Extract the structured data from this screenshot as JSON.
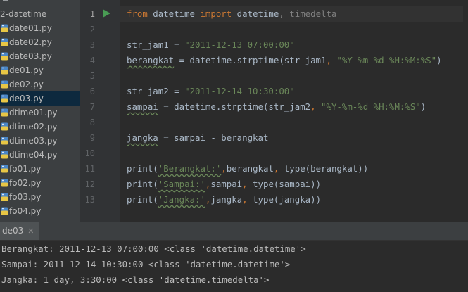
{
  "project_tree": {
    "root_label": "2-datetime",
    "files": [
      "date01.py",
      "date02.py",
      "date03.py",
      "de01.py",
      "de02.py",
      "de03.py",
      "dtime01.py",
      "dtime02.py",
      "dtime03.py",
      "dtime04.py",
      "fo01.py",
      "fo02.py",
      "fo03.py",
      "fo04.py"
    ],
    "selected": "de03.py"
  },
  "editor": {
    "line_numbers": [
      "1",
      "2",
      "3",
      "4",
      "5",
      "6",
      "7",
      "8",
      "9",
      "10",
      "11",
      "12",
      "13"
    ],
    "current_line": "1",
    "code": {
      "l1": {
        "from": "from",
        "mod": " datetime ",
        "import": "import",
        "names": " datetime",
        "rest": ", timedelta"
      },
      "l3": {
        "a": "str_jam1 = ",
        "s": "\"2011-12-13 07:00:00\""
      },
      "l4": {
        "a": "berangkat",
        "b": " = datetime.strptime(str_jam1",
        "c": ", ",
        "s": "\"%Y-%m-%d %H:%M:%S\"",
        "d": ")"
      },
      "l6": {
        "a": "str_jam2 = ",
        "s": "\"2011-12-14 10:30:00\""
      },
      "l7": {
        "a": "sampai",
        "b": " = datetime.strptime(str_jam2",
        "c": ", ",
        "s": "\"%Y-%m-%d %H:%M:%S\"",
        "d": ")"
      },
      "l9": {
        "a": "jangka",
        "b": " = sampai - berangkat"
      },
      "l11": {
        "p": "print(",
        "s": "'Berangkat:'",
        "c": ",",
        "v": "berangkat",
        "m": ", ",
        "t": "type(berangkat))"
      },
      "l12": {
        "p": "print(",
        "s": "'Sampai:'",
        "c": ",",
        "v": "sampai",
        "m": ", ",
        "t": "type(sampai))"
      },
      "l13": {
        "p": "print(",
        "s": "'Jangka:'",
        "c": ",",
        "v": "jangka",
        "m": ", ",
        "t": "type(jangka))"
      }
    }
  },
  "run_panel": {
    "tab_label": "de03",
    "tab_close": "✕",
    "output": [
      "Berangkat: 2011-12-13 07:00:00 <class 'datetime.datetime'>",
      "Sampai: 2011-12-14 10:30:00 <class 'datetime.datetime'>",
      "Jangka: 1 day, 3:30:00 <class 'datetime.timedelta'>"
    ]
  },
  "colors": {
    "keyword": "#cc7832",
    "string": "#6a8759",
    "text": "#a9b7c6",
    "run_icon": "#499c54",
    "selection": "#0d293e"
  }
}
